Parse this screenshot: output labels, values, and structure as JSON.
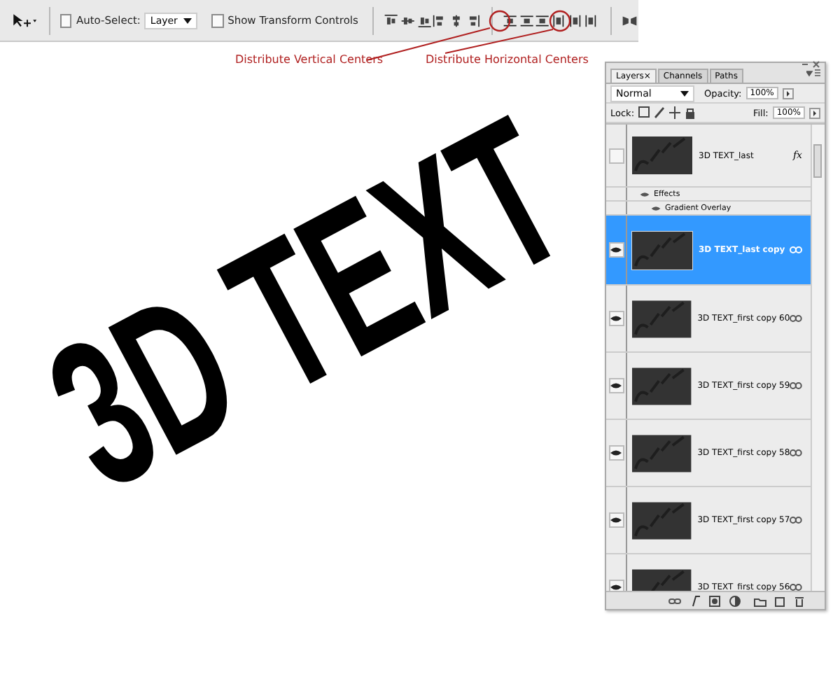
{
  "toolbar": {
    "auto_select": {
      "label": "Auto-Select:",
      "checked": false
    },
    "auto_select_target": "Layer",
    "transform_controls": {
      "label": "Show Transform Controls",
      "checked": false
    }
  },
  "annotations": [
    {
      "text": "Distribute Vertical Centers"
    },
    {
      "text": "Distribute Horizontal Centers"
    }
  ],
  "canvas": {
    "text": "3D TEXT"
  },
  "layers_panel": {
    "tabs": [
      {
        "label": "Layers",
        "selected": true,
        "close": "×"
      },
      {
        "label": "Channels",
        "selected": false
      },
      {
        "label": "Paths",
        "selected": false
      }
    ],
    "blend_mode": "Normal",
    "opacity_label": "Opacity:",
    "opacity": "100%",
    "lock_label": "Lock:",
    "fill_label": "Fill:",
    "fill": "100%",
    "layers": [
      {
        "name": "3D TEXT_last",
        "visible": false,
        "selected": false,
        "linked": false,
        "fx": "fx",
        "effects": {
          "label": "Effects",
          "items": [
            "Gradient Overlay"
          ]
        }
      },
      {
        "name": "3D TEXT_last copy",
        "visible": true,
        "selected": true,
        "linked": true
      },
      {
        "name": "3D TEXT_first copy 60",
        "visible": true,
        "selected": false,
        "linked": true
      },
      {
        "name": "3D TEXT_first copy 59",
        "visible": true,
        "selected": false,
        "linked": true
      },
      {
        "name": "3D TEXT_first copy 58",
        "visible": true,
        "selected": false,
        "linked": true
      },
      {
        "name": "3D TEXT_first copy 57",
        "visible": true,
        "selected": false,
        "linked": true
      },
      {
        "name": "3D TEXT_first copy 56",
        "visible": true,
        "selected": false,
        "linked": true
      }
    ]
  }
}
